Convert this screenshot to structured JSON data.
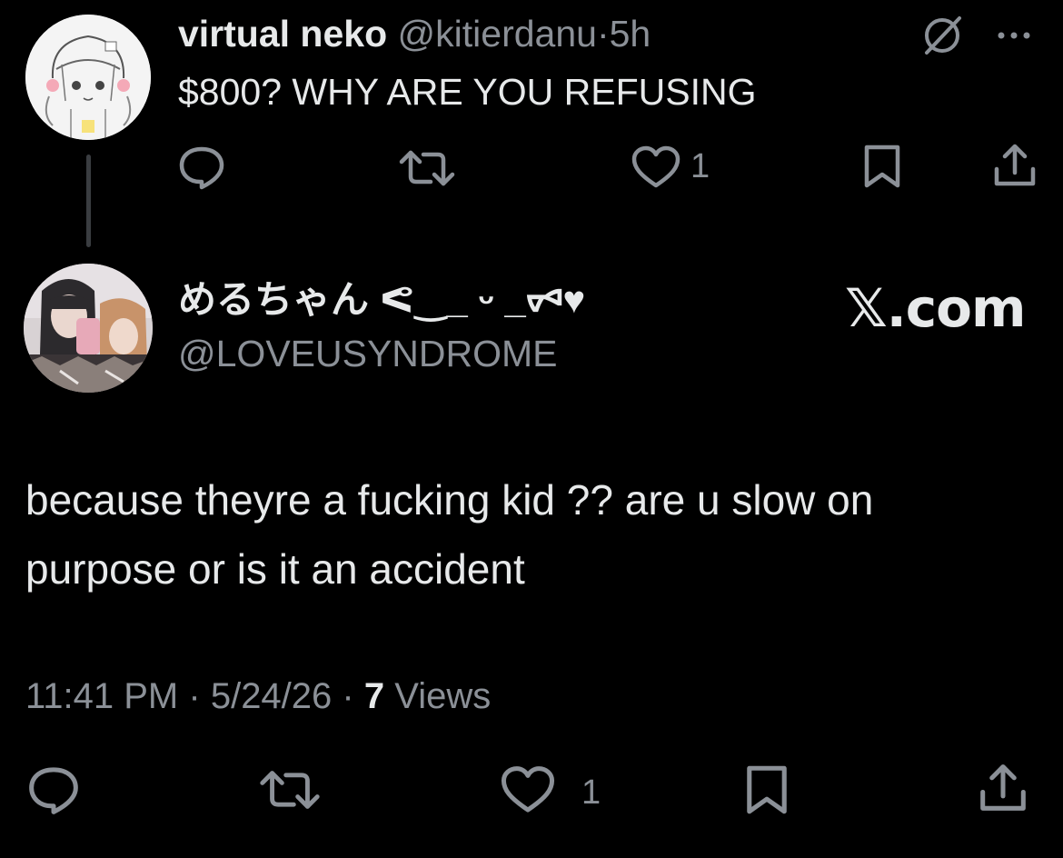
{
  "parent_tweet": {
    "display_name": "virtual neko",
    "handle": "@kitierdanu",
    "separator": "·",
    "time": "5h",
    "text": "$800? WHY ARE YOU REFUSING",
    "actions": {
      "reply_icon": "speech-bubble-icon",
      "retweet_icon": "retweet-icon",
      "like_icon": "heart-icon",
      "like_count": "1",
      "bookmark_icon": "bookmark-icon",
      "share_icon": "share-icon"
    },
    "header_icons": [
      "grok-icon",
      "more-icon"
    ]
  },
  "reply_tweet": {
    "display_name": "めるちゃん ᕙ‿_ ᵕ _ᢦᢦ♥",
    "handle": "@LOVEUSYNDROME",
    "watermark": "𝕏.com",
    "text": "because theyre a fucking kid ?? are u slow on purpose or is it an accident",
    "timestamp": "11:41 PM",
    "date": "5/24/26",
    "separator": "·",
    "views_count": "7",
    "views_label": "Views",
    "actions": {
      "like_count": "1"
    }
  },
  "colors": {
    "background": "#000000",
    "primary_text": "#e7e9ea",
    "secondary_text": "#8b9097",
    "thread_line": "#3a3d41"
  }
}
